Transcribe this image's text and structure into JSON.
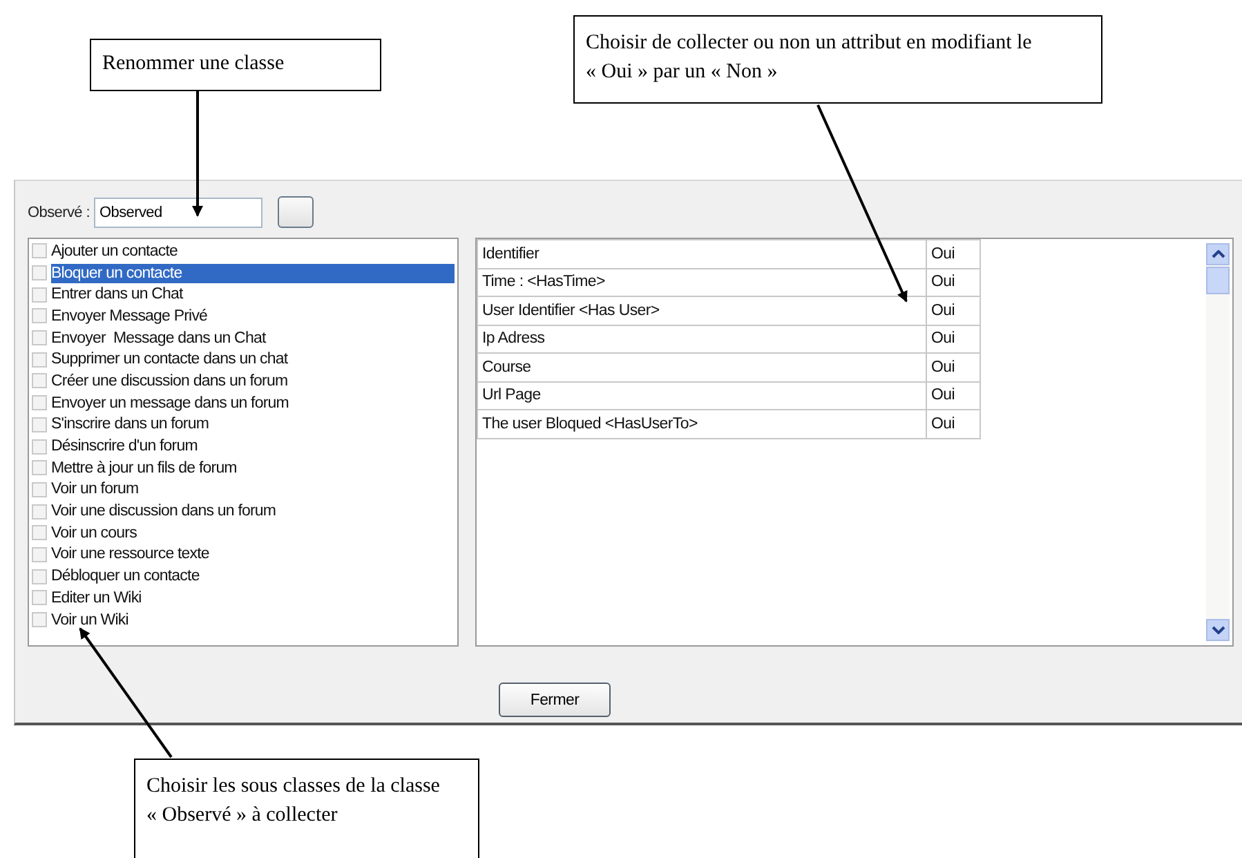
{
  "annotations": [
    {
      "text": "Renommer une classe"
    },
    {
      "text": "Choisir de collecter ou non un attribut en modifiant le « Oui » par un « Non »"
    },
    {
      "text": "Choisir les sous classes de la classe « Observé » à collecter"
    }
  ],
  "dialog": {
    "field_label": "Observé :",
    "field_value": "Observed",
    "subclasses": [
      {
        "label": "Ajouter un contacte",
        "checked": false,
        "selected": false
      },
      {
        "label": "Bloquer un contacte",
        "checked": false,
        "selected": true
      },
      {
        "label": "Entrer dans un Chat",
        "checked": false,
        "selected": false
      },
      {
        "label": "Envoyer Message Privé",
        "checked": false,
        "selected": false
      },
      {
        "label": "Envoyer  Message dans un Chat",
        "checked": false,
        "selected": false
      },
      {
        "label": "Supprimer un contacte dans un chat",
        "checked": false,
        "selected": false
      },
      {
        "label": "Créer une discussion dans un forum",
        "checked": false,
        "selected": false
      },
      {
        "label": "Envoyer un message dans un forum",
        "checked": false,
        "selected": false
      },
      {
        "label": "S'inscrire dans un forum",
        "checked": false,
        "selected": false
      },
      {
        "label": "Désinscrire d'un forum",
        "checked": false,
        "selected": false
      },
      {
        "label": "Mettre à jour un fils de forum",
        "checked": false,
        "selected": false
      },
      {
        "label": "Voir un forum",
        "checked": false,
        "selected": false
      },
      {
        "label": "Voir une discussion dans un forum",
        "checked": false,
        "selected": false
      },
      {
        "label": "Voir un cours",
        "checked": false,
        "selected": false
      },
      {
        "label": "Voir une ressource texte",
        "checked": false,
        "selected": false
      },
      {
        "label": "Débloquer un contacte",
        "checked": false,
        "selected": false
      },
      {
        "label": "Editer un Wiki",
        "checked": false,
        "selected": false
      },
      {
        "label": "Voir un Wiki",
        "checked": false,
        "selected": false
      }
    ],
    "attributes": [
      {
        "name": "Identifier",
        "collect": "Oui"
      },
      {
        "name": "Time : <HasTime>",
        "collect": "Oui"
      },
      {
        "name": "User Identifier <Has User>",
        "collect": "Oui"
      },
      {
        "name": "Ip Adress",
        "collect": "Oui"
      },
      {
        "name": "Course",
        "collect": "Oui"
      },
      {
        "name": "Url Page",
        "collect": "Oui"
      },
      {
        "name": "The user Bloqued <HasUserTo>",
        "collect": "Oui"
      }
    ],
    "buttons": [
      "Fermer"
    ]
  }
}
